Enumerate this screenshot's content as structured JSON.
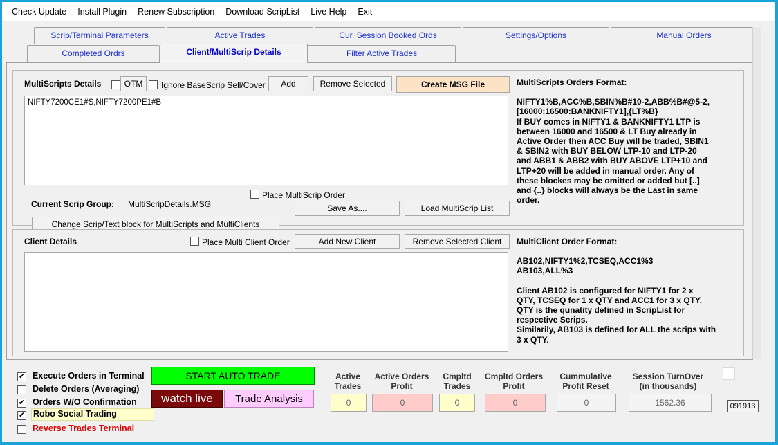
{
  "menu": [
    "Check Update",
    "Install Plugin",
    "Renew Subscription",
    "Download ScripList",
    "Live Help",
    "Exit"
  ],
  "tabs_row1": [
    "Scrip/Terminal Parameters",
    "Active Trades",
    "Cur. Session Booked Ords",
    "Settings/Options",
    "Manual Orders"
  ],
  "tabs_row2": [
    "Completed Ordrs",
    "Client/MultiScrip Details",
    "Filter Active Trades"
  ],
  "multi": {
    "title": "MultiScripts Details",
    "otm_label": "OTM",
    "ignore_label": "Ignore BaseScrip Sell/Cover",
    "add_label": "Add",
    "remove_label": "Remove Selected",
    "create_label": "Create MSG File",
    "text_value": "NIFTY7200CE1#S,NIFTY7200PE1#B",
    "place_label": "Place MultiScrip Order",
    "group_label": "Current Scrip Group:",
    "group_value": "MultiScripDetails.MSG",
    "save_label": "Save As....",
    "load_label": "Load MultiScrip List",
    "change_label": "Change Scrip/Text block for MultiScripts and MultiClients"
  },
  "multi_format": {
    "title": "MultiScripts Orders Format:",
    "lines": [
      "NIFTY1%B,ACC%B,SBIN%B#10-2,ABB%B#@5-2,",
      "[16000:16500:BANKNIFTY1],{LT%B}",
      "If BUY comes in NIFTY1 & BANKNIFTY1 LTP is",
      "between 16000 and 16500 & LT Buy already in",
      "Active Order then ACC Buy will be traded, SBIN1",
      "& SBIN2 with BUY BELOW LTP-10 and LTP-20",
      "and ABB1 & ABB2 with BUY ABOVE LTP+10 and",
      "LTP+20 will be added in manual order. Any of",
      "these blockes may be omitted or added but [..]",
      "and {..} blocks will always be the Last in same",
      "order."
    ]
  },
  "client": {
    "title": "Client Details",
    "place_label": "Place Multi Client Order",
    "add_label": "Add New Client",
    "remove_label": "Remove Selected Client"
  },
  "client_format": {
    "title": "MultiClient Order Format:",
    "lines": [
      "AB102,NIFTY1%2,TCSEQ,ACC1%3",
      "AB103,ALL%3",
      "",
      "Client AB102 is configured for NIFTY1 for 2 x",
      "QTY, TCSEQ for 1 x QTY and ACC1 for 3 x QTY.",
      "QTY is the qunatity defined in ScripList for",
      "respective Scrips.",
      "Similarily, AB103 is defined for ALL the scrips with",
      "3 x QTY."
    ]
  },
  "bottom": {
    "exec_label": "Execute Orders in Terminal",
    "delete_label": "Delete Orders (Averaging)",
    "wo_label": "Orders W/O Confirmation",
    "robo_label": "Robo Social Trading",
    "reverse_label": "Reverse Trades Terminal",
    "start_label": "START AUTO TRADE",
    "watch_label": "watch live",
    "analysis_label": "Trade Analysis",
    "check_mark": "✔",
    "stats": [
      {
        "h1": "Active",
        "h2": "Trades",
        "value": "0"
      },
      {
        "h1": "Active Orders",
        "h2": "Profit",
        "value": "0"
      },
      {
        "h1": "Cmpltd",
        "h2": "Trades",
        "value": "0"
      },
      {
        "h1": "Cmpltd Orders",
        "h2": "Profit",
        "value": "0"
      },
      {
        "h1": "Cummulative",
        "h2": "Profit Reset",
        "value": "0"
      },
      {
        "h1": "Session TurnOver",
        "h2": "(in thousands)",
        "value": "1562.36"
      }
    ],
    "code": "091913"
  },
  "colors": {
    "tab_text": "#1a2fd0",
    "start_bg": "#00ff00",
    "watch_bg": "#7a0a0a",
    "analysis_bg": "#ffccff",
    "robo_bg": "#ffffcc",
    "reverse_text": "#e00000",
    "yellow_box": "#ffffcc",
    "pink_box": "#ffcccc"
  }
}
